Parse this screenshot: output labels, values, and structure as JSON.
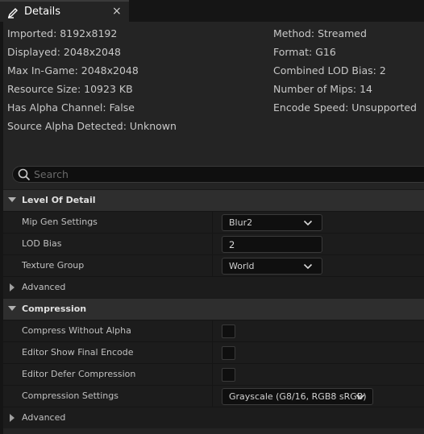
{
  "tab": {
    "title": "Details",
    "close_glyph": "×",
    "icon": "pencil-icon"
  },
  "info": {
    "left": [
      "Imported: 8192x8192",
      "Displayed: 2048x2048",
      "Max In-Game: 2048x2048",
      "Resource Size: 10923 KB",
      "Has Alpha Channel: False",
      "Source Alpha Detected: Unknown"
    ],
    "right": [
      "Method: Streamed",
      "Format: G16",
      "Combined LOD Bias: 2",
      "Number of Mips: 14",
      "Encode Speed: Unsupported"
    ]
  },
  "search": {
    "placeholder": "Search",
    "icon": "search-icon"
  },
  "lod": {
    "title": "Level Of Detail",
    "mip_gen_label": "Mip Gen Settings",
    "mip_gen_value": "Blur2",
    "lod_bias_label": "LOD Bias",
    "lod_bias_value": "2",
    "texture_group_label": "Texture Group",
    "texture_group_value": "World",
    "advanced_label": "Advanced"
  },
  "compression": {
    "title": "Compression",
    "compress_without_alpha_label": "Compress Without Alpha",
    "compress_without_alpha_checked": false,
    "editor_show_final_encode_label": "Editor Show Final Encode",
    "editor_show_final_encode_checked": false,
    "editor_defer_compression_label": "Editor Defer Compression",
    "editor_defer_compression_checked": false,
    "compression_settings_label": "Compression Settings",
    "compression_settings_value": "Grayscale (G8/16, RGB8 sRGB)",
    "advanced_label": "Advanced"
  },
  "colors": {
    "panel": "#242424",
    "background": "#151515",
    "input": "#0f0f0f",
    "text": "#c0c0c0"
  }
}
